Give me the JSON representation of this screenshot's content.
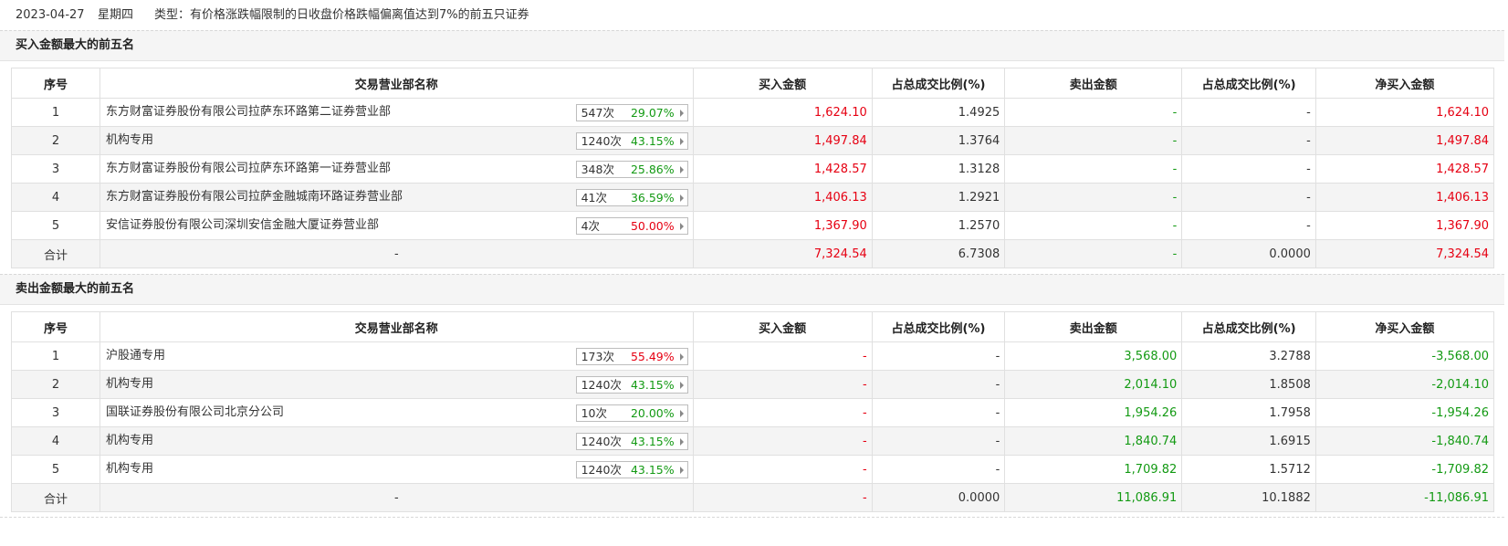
{
  "header": {
    "date": "2023-04-27",
    "weekday": "星期四",
    "type_label": "类型：有价格涨跌幅限制的日收盘价格跌幅偏离值达到7%的前五只证券"
  },
  "columns": [
    "序号",
    "交易营业部名称",
    "买入金额",
    "占总成交比例(%)",
    "卖出金额",
    "占总成交比例(%)",
    "净买入金额"
  ],
  "colors": {
    "red": "#e60012",
    "green": "#139a13"
  },
  "buy_section": {
    "title": "买入金额最大的前五名",
    "rows": [
      {
        "rank": "1",
        "name": "东方财富证券股份有限公司拉萨东环路第二证券营业部",
        "count": "547次",
        "pct": "29.07%",
        "pct_color": "green",
        "buy": "1,624.10",
        "buy_ratio": "1.4925",
        "sell": "-",
        "sell_ratio": "-",
        "net": "1,624.10"
      },
      {
        "rank": "2",
        "name": "机构专用",
        "count": "1240次",
        "pct": "43.15%",
        "pct_color": "green",
        "buy": "1,497.84",
        "buy_ratio": "1.3764",
        "sell": "-",
        "sell_ratio": "-",
        "net": "1,497.84"
      },
      {
        "rank": "3",
        "name": "东方财富证券股份有限公司拉萨东环路第一证券营业部",
        "count": "348次",
        "pct": "25.86%",
        "pct_color": "green",
        "buy": "1,428.57",
        "buy_ratio": "1.3128",
        "sell": "-",
        "sell_ratio": "-",
        "net": "1,428.57"
      },
      {
        "rank": "4",
        "name": "东方财富证券股份有限公司拉萨金融城南环路证券营业部",
        "count": "41次",
        "pct": "36.59%",
        "pct_color": "green",
        "buy": "1,406.13",
        "buy_ratio": "1.2921",
        "sell": "-",
        "sell_ratio": "-",
        "net": "1,406.13"
      },
      {
        "rank": "5",
        "name": "安信证券股份有限公司深圳安信金融大厦证券营业部",
        "count": "4次",
        "pct": "50.00%",
        "pct_color": "red",
        "buy": "1,367.90",
        "buy_ratio": "1.2570",
        "sell": "-",
        "sell_ratio": "-",
        "net": "1,367.90"
      }
    ],
    "total": {
      "label": "合计",
      "name": "-",
      "buy": "7,324.54",
      "buy_ratio": "6.7308",
      "sell": "-",
      "sell_ratio": "0.0000",
      "net": "7,324.54"
    }
  },
  "sell_section": {
    "title": "卖出金额最大的前五名",
    "rows": [
      {
        "rank": "1",
        "name": "沪股通专用",
        "count": "173次",
        "pct": "55.49%",
        "pct_color": "red",
        "buy": "-",
        "buy_ratio": "-",
        "sell": "3,568.00",
        "sell_ratio": "3.2788",
        "net": "-3,568.00"
      },
      {
        "rank": "2",
        "name": "机构专用",
        "count": "1240次",
        "pct": "43.15%",
        "pct_color": "green",
        "buy": "-",
        "buy_ratio": "-",
        "sell": "2,014.10",
        "sell_ratio": "1.8508",
        "net": "-2,014.10"
      },
      {
        "rank": "3",
        "name": "国联证券股份有限公司北京分公司",
        "count": "10次",
        "pct": "20.00%",
        "pct_color": "green",
        "buy": "-",
        "buy_ratio": "-",
        "sell": "1,954.26",
        "sell_ratio": "1.7958",
        "net": "-1,954.26"
      },
      {
        "rank": "4",
        "name": "机构专用",
        "count": "1240次",
        "pct": "43.15%",
        "pct_color": "green",
        "buy": "-",
        "buy_ratio": "-",
        "sell": "1,840.74",
        "sell_ratio": "1.6915",
        "net": "-1,840.74"
      },
      {
        "rank": "5",
        "name": "机构专用",
        "count": "1240次",
        "pct": "43.15%",
        "pct_color": "green",
        "buy": "-",
        "buy_ratio": "-",
        "sell": "1,709.82",
        "sell_ratio": "1.5712",
        "net": "-1,709.82"
      }
    ],
    "total": {
      "label": "合计",
      "name": "-",
      "buy": "-",
      "buy_ratio": "0.0000",
      "sell": "11,086.91",
      "sell_ratio": "10.1882",
      "net": "-11,086.91"
    }
  }
}
